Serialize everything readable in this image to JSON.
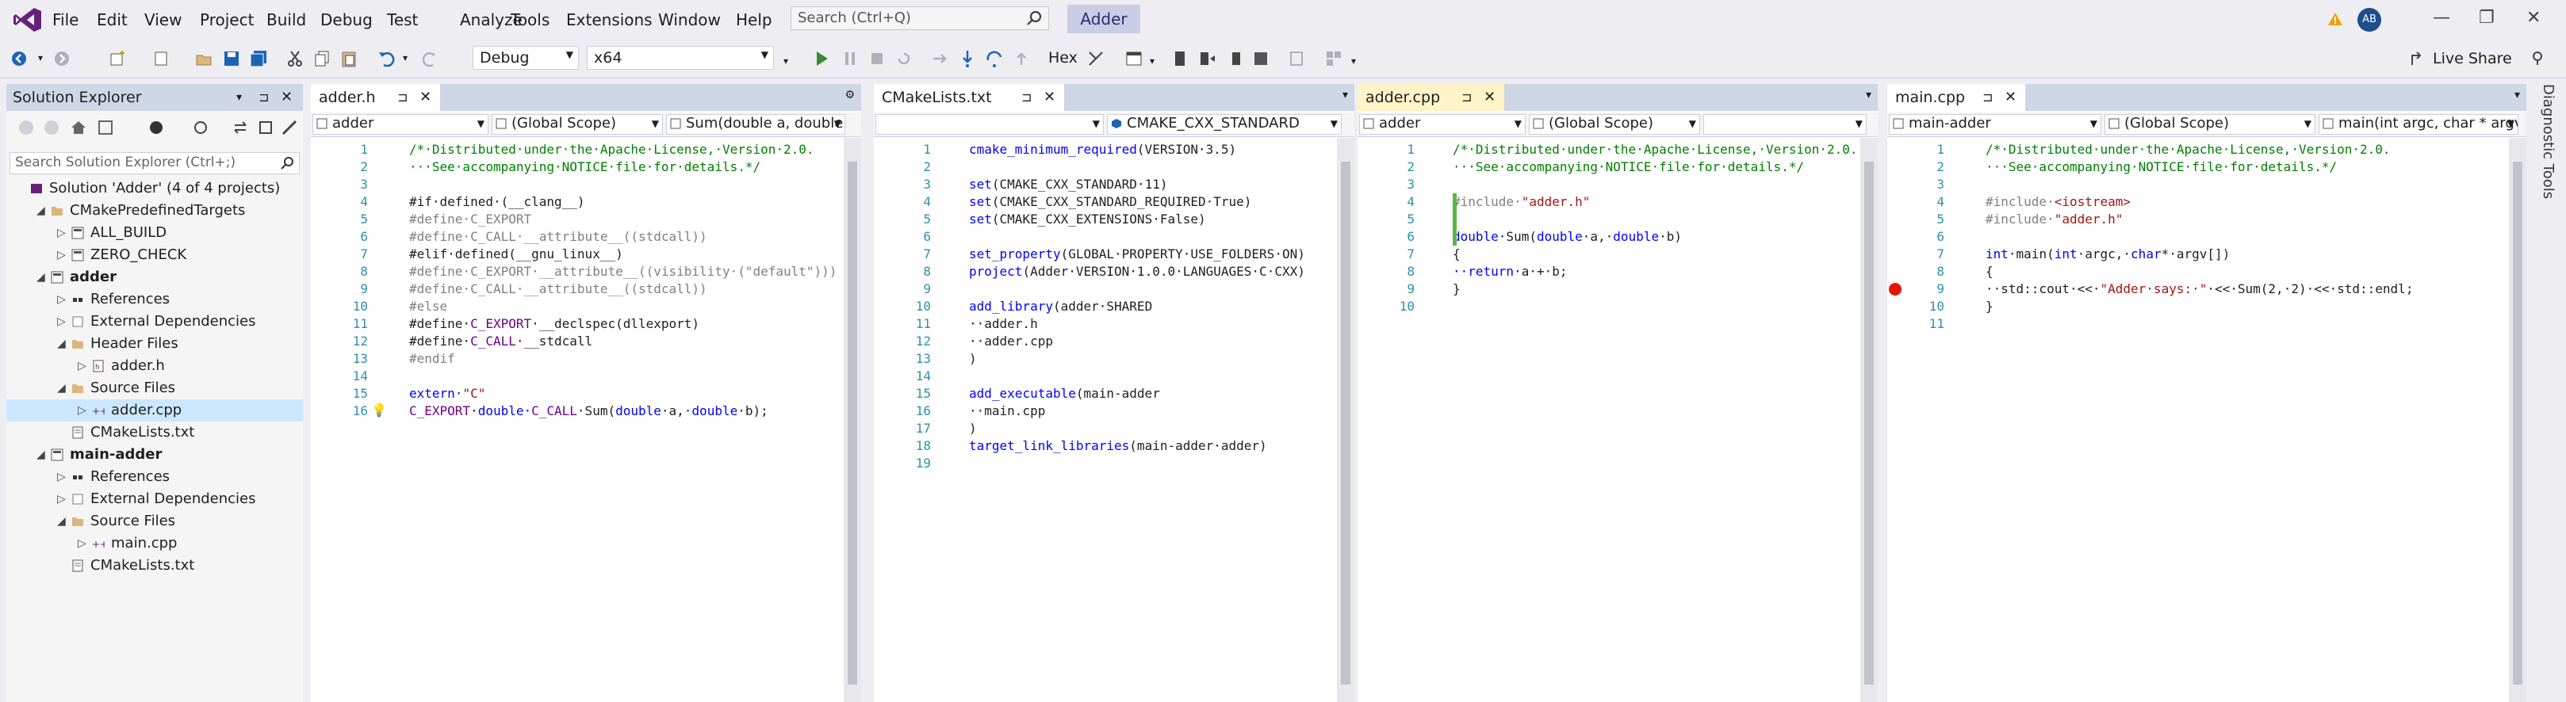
{
  "menu": [
    "File",
    "Edit",
    "View",
    "Project",
    "Build",
    "Debug",
    "Test",
    "Analyze",
    "Tools",
    "Extensions",
    "Window",
    "Help"
  ],
  "search": {
    "placeholder": "Search (Ctrl+Q)"
  },
  "solution_name": "Adder",
  "user_initials": "AB",
  "toolbar": {
    "config": "Debug",
    "platform": "x64",
    "hex": "Hex",
    "live_share": "Live Share"
  },
  "solution_explorer": {
    "title": "Solution Explorer",
    "search_placeholder": "Search Solution Explorer (Ctrl+;)",
    "rows": [
      {
        "label": "Solution 'Adder' (4 of 4 projects)",
        "indent": 0,
        "exp": "",
        "icon": "solution"
      },
      {
        "label": "CMakePredefinedTargets",
        "indent": 1,
        "exp": "◢",
        "icon": "folder"
      },
      {
        "label": "ALL_BUILD",
        "indent": 2,
        "exp": "▷",
        "icon": "project"
      },
      {
        "label": "ZERO_CHECK",
        "indent": 2,
        "exp": "▷",
        "icon": "project"
      },
      {
        "label": "adder",
        "indent": 1,
        "exp": "◢",
        "icon": "project"
      },
      {
        "label": "References",
        "indent": 2,
        "exp": "▷",
        "icon": "refs"
      },
      {
        "label": "External Dependencies",
        "indent": 2,
        "exp": "▷",
        "icon": "extdep"
      },
      {
        "label": "Header Files",
        "indent": 2,
        "exp": "◢",
        "icon": "folder"
      },
      {
        "label": "adder.h",
        "indent": 3,
        "exp": "▷",
        "icon": "hfile"
      },
      {
        "label": "Source Files",
        "indent": 2,
        "exp": "◢",
        "icon": "folder"
      },
      {
        "label": "adder.cpp",
        "indent": 3,
        "exp": "▷",
        "icon": "cppfile"
      },
      {
        "label": "CMakeLists.txt",
        "indent": 2,
        "exp": "",
        "icon": "txtfile"
      },
      {
        "label": "main-adder",
        "indent": 1,
        "exp": "◢",
        "icon": "project"
      },
      {
        "label": "References",
        "indent": 2,
        "exp": "▷",
        "icon": "refs"
      },
      {
        "label": "External Dependencies",
        "indent": 2,
        "exp": "▷",
        "icon": "extdep"
      },
      {
        "label": "Source Files",
        "indent": 2,
        "exp": "◢",
        "icon": "folder"
      },
      {
        "label": "main.cpp",
        "indent": 3,
        "exp": "▷",
        "icon": "cppfile"
      },
      {
        "label": "CMakeLists.txt",
        "indent": 2,
        "exp": "",
        "icon": "txtfile"
      }
    ]
  },
  "editors": [
    {
      "tab": "adder.h",
      "active": false,
      "nav": [
        "adder",
        "(Global Scope)",
        "Sum(double a, double"
      ],
      "lines": [
        [
          [
            "/*·Distributed·under·the·Apache·License,·Version·2.0.",
            "green"
          ]
        ],
        [
          [
            "···See·accompanying·NOTICE·file·for·details.*/",
            "green"
          ]
        ],
        [],
        [
          [
            "#if·defined·(__clang__)",
            "plain"
          ]
        ],
        [
          [
            "#define·C_EXPORT",
            "gray"
          ]
        ],
        [
          [
            "#define·C_CALL·__attribute__((stdcall))",
            "gray"
          ]
        ],
        [
          [
            "#elif·defined(__gnu_linux__)",
            "plain"
          ]
        ],
        [
          [
            "#define·C_EXPORT·__attribute__((visibility·(\"default\")))",
            "gray"
          ]
        ],
        [
          [
            "#define·C_CALL·__attribute__((stdcall))",
            "gray"
          ]
        ],
        [
          [
            "#else",
            "gray"
          ]
        ],
        [
          [
            "#define·",
            "plain"
          ],
          [
            "C_EXPORT",
            "purple"
          ],
          [
            "·__declspec(dllexport)",
            "plain"
          ]
        ],
        [
          [
            "#define·",
            "plain"
          ],
          [
            "C_CALL",
            "purple"
          ],
          [
            "·__stdcall",
            "plain"
          ]
        ],
        [
          [
            "#endif",
            "gray"
          ]
        ],
        [],
        [
          [
            "extern·",
            "blue"
          ],
          [
            "\"C\"",
            "red"
          ]
        ],
        [
          [
            "C_EXPORT",
            "purple"
          ],
          [
            "·double·",
            "blue"
          ],
          [
            "C_CALL",
            "purple"
          ],
          [
            "·Sum(",
            "plain"
          ],
          [
            "double",
            "blue"
          ],
          [
            "·a,·",
            "plain"
          ],
          [
            "double",
            "blue"
          ],
          [
            "·b);",
            "plain"
          ]
        ]
      ]
    },
    {
      "tab": "CMakeLists.txt",
      "active": false,
      "nav": [
        "",
        "CMAKE_CXX_STANDARD"
      ],
      "lines": [
        [
          [
            "cmake_minimum_required",
            "blue"
          ],
          [
            "(VERSION·3.5)",
            "plain"
          ]
        ],
        [],
        [
          [
            "set",
            "blue"
          ],
          [
            "(CMAKE_CXX_STANDARD·11)",
            "plain"
          ]
        ],
        [
          [
            "set",
            "blue"
          ],
          [
            "(CMAKE_CXX_STANDARD_REQUIRED·True)",
            "plain"
          ]
        ],
        [
          [
            "set",
            "blue"
          ],
          [
            "(CMAKE_CXX_EXTENSIONS·False)",
            "plain"
          ]
        ],
        [],
        [
          [
            "set_property",
            "blue"
          ],
          [
            "(GLOBAL·PROPERTY·USE_FOLDERS·ON)",
            "plain"
          ]
        ],
        [
          [
            "project",
            "blue"
          ],
          [
            "(Adder·VERSION·1.0.0·LANGUAGES·C·CXX)",
            "plain"
          ]
        ],
        [],
        [
          [
            "add_library",
            "blue"
          ],
          [
            "(adder·SHARED",
            "plain"
          ]
        ],
        [
          [
            "··adder.h",
            "plain"
          ]
        ],
        [
          [
            "··adder.cpp",
            "plain"
          ]
        ],
        [
          [
            ")",
            "plain"
          ]
        ],
        [],
        [
          [
            "add_executable",
            "blue"
          ],
          [
            "(main-adder",
            "plain"
          ]
        ],
        [
          [
            "··main.cpp",
            "plain"
          ]
        ],
        [
          [
            ")",
            "plain"
          ]
        ],
        [
          [
            "target_link_libraries",
            "blue"
          ],
          [
            "(main-adder·adder)",
            "plain"
          ]
        ],
        []
      ]
    },
    {
      "tab": "adder.cpp",
      "active": true,
      "nav": [
        "adder",
        "(Global Scope)",
        ""
      ],
      "lines": [
        [
          [
            "/*·Distributed·under·the·Apache·License,·Version·2.0.",
            "green"
          ]
        ],
        [
          [
            "···See·accompanying·NOTICE·file·for·details.*/",
            "green"
          ]
        ],
        [],
        [
          [
            "#include·",
            "gray"
          ],
          [
            "\"adder.h\"",
            "red"
          ]
        ],
        [],
        [
          [
            "double",
            "blue"
          ],
          [
            "·Sum(",
            "plain"
          ],
          [
            "double",
            "blue"
          ],
          [
            "·a,·",
            "plain"
          ],
          [
            "double",
            "blue"
          ],
          [
            "·b)",
            "plain"
          ]
        ],
        [
          [
            "{",
            "plain"
          ]
        ],
        [
          [
            "··return·",
            "blue"
          ],
          [
            "a·+·b;",
            "plain"
          ]
        ],
        [
          [
            "}",
            "plain"
          ]
        ],
        []
      ]
    },
    {
      "tab": "main.cpp",
      "active": false,
      "nav": [
        "main-adder",
        "(Global Scope)",
        "main(int argc, char * argv[])"
      ],
      "lines": [
        [
          [
            "/*·Distributed·under·the·Apache·License,·Version·2.0.",
            "green"
          ]
        ],
        [
          [
            "···See·accompanying·NOTICE·file·for·details.*/",
            "green"
          ]
        ],
        [],
        [
          [
            "#include·",
            "gray"
          ],
          [
            "<iostream>",
            "red"
          ]
        ],
        [
          [
            "#include·",
            "gray"
          ],
          [
            "\"adder.h\"",
            "red"
          ]
        ],
        [],
        [
          [
            "int",
            "blue"
          ],
          [
            "·main(",
            "plain"
          ],
          [
            "int",
            "blue"
          ],
          [
            "·argc,·",
            "plain"
          ],
          [
            "char",
            "blue"
          ],
          [
            "*·argv[])",
            "plain"
          ]
        ],
        [
          [
            "{",
            "plain"
          ]
        ],
        [
          [
            "··std::cout·<<·",
            "plain"
          ],
          [
            "\"Adder·says:·\"",
            "red"
          ],
          [
            "·<<·Sum(2,·2)·<<·std::endl;",
            "plain"
          ]
        ],
        [
          [
            "}",
            "plain"
          ]
        ],
        []
      ]
    }
  ],
  "side_tab": "Diagnostic Tools"
}
